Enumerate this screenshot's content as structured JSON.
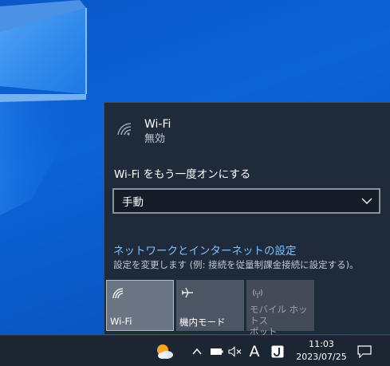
{
  "flyout": {
    "wifi": {
      "name": "Wi-Fi",
      "status": "無効",
      "icon": "wifi-off-icon"
    },
    "turn_on_label": "Wi-Fi をもう一度オンにする",
    "turn_on_option": "手動",
    "settings_link": "ネットワークとインターネットの設定",
    "settings_desc": "設定を変更します (例: 接続を従量制課金接続に設定する)。",
    "tiles": [
      {
        "label": "Wi-Fi",
        "icon": "wifi-icon",
        "state": "selected"
      },
      {
        "label": "機内モード",
        "icon": "airplane-icon",
        "state": "normal"
      },
      {
        "label": "モバイル ホットス\nポット",
        "label_line1": "モバイル ホットス",
        "label_line2": "ポット",
        "icon": "hotspot-icon",
        "state": "disabled"
      }
    ]
  },
  "taskbar": {
    "ime_mode": "A",
    "time": "11:03",
    "date": "2023/07/25"
  },
  "colors": {
    "accent_link": "#7ac2ff",
    "flyout_bg": "#1f2a3a",
    "taskbar_bg": "#1c2633",
    "desktop": "#0c63d6"
  }
}
